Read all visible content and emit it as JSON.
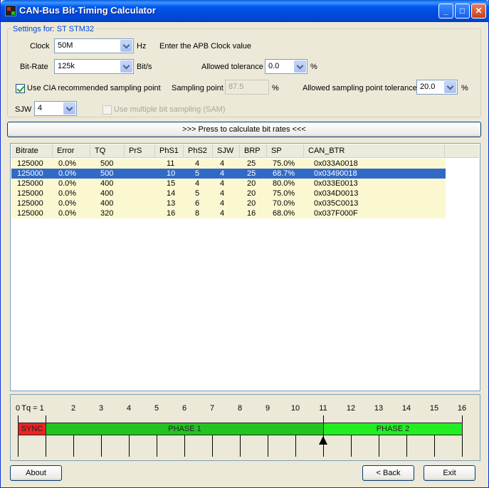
{
  "window": {
    "title": "CAN-Bus Bit-Timing Calculator"
  },
  "settings": {
    "legend": "Settings for: ST STM32",
    "clock_label": "Clock",
    "clock_value": "50M",
    "clock_unit": "Hz",
    "clock_hint": "Enter the APB Clock value",
    "bitrate_label": "Bit-Rate",
    "bitrate_value": "125k",
    "bitrate_unit": "Bit/s",
    "tolerance_label": "Allowed tolerance",
    "tolerance_value": "0.0",
    "tolerance_unit": "%",
    "cia_label": "Use CIA recommended sampling point",
    "cia_checked": true,
    "sampling_point_label": "Sampling point",
    "sampling_point_value": "87.5",
    "sampling_point_unit": "%",
    "sp_tolerance_label": "Allowed sampling point tolerance",
    "sp_tolerance_value": "20.0",
    "sp_tolerance_unit": "%",
    "sjw_label": "SJW",
    "sjw_value": "4",
    "sam_label": "Use multiple bit sampling (SAM)",
    "sam_checked": false
  },
  "calculate_button": ">>> Press to calculate bit rates <<<",
  "table": {
    "columns": [
      "Bitrate",
      "Error",
      "TQ",
      "PrS",
      "PhS1",
      "PhS2",
      "SJW",
      "BRP",
      "SP",
      "CAN_BTR"
    ],
    "rows": [
      [
        "125000",
        "0.0%",
        "500",
        "",
        "11",
        "4",
        "4",
        "25",
        "75.0%",
        "0x033A0018"
      ],
      [
        "125000",
        "0.0%",
        "500",
        "",
        "10",
        "5",
        "4",
        "25",
        "68.7%",
        "0x03490018"
      ],
      [
        "125000",
        "0.0%",
        "400",
        "",
        "15",
        "4",
        "4",
        "20",
        "80.0%",
        "0x033E0013"
      ],
      [
        "125000",
        "0.0%",
        "400",
        "",
        "14",
        "5",
        "4",
        "20",
        "75.0%",
        "0x034D0013"
      ],
      [
        "125000",
        "0.0%",
        "400",
        "",
        "13",
        "6",
        "4",
        "20",
        "70.0%",
        "0x035C0013"
      ],
      [
        "125000",
        "0.0%",
        "320",
        "",
        "16",
        "8",
        "4",
        "16",
        "68.0%",
        "0x037F000F"
      ]
    ],
    "selected_row": 1
  },
  "timing": {
    "tick_labels": [
      "0",
      "Tq = 1",
      "2",
      "3",
      "4",
      "5",
      "6",
      "7",
      "8",
      "9",
      "10",
      "11",
      "12",
      "13",
      "14",
      "15",
      "16"
    ],
    "sync_label": "SYNC",
    "phase1_label": "PHASE 1",
    "phase2_label": "PHASE 2",
    "sync_tq": 1,
    "phase1_tq": 10,
    "phase2_tq": 5,
    "total_tq": 16,
    "sample_point_tq": 11,
    "colors": {
      "sync": "#ee2222",
      "phase1": "#22c422",
      "phase2": "#22ee22"
    }
  },
  "buttons": {
    "about": "About",
    "back": "< Back",
    "exit": "Exit"
  }
}
